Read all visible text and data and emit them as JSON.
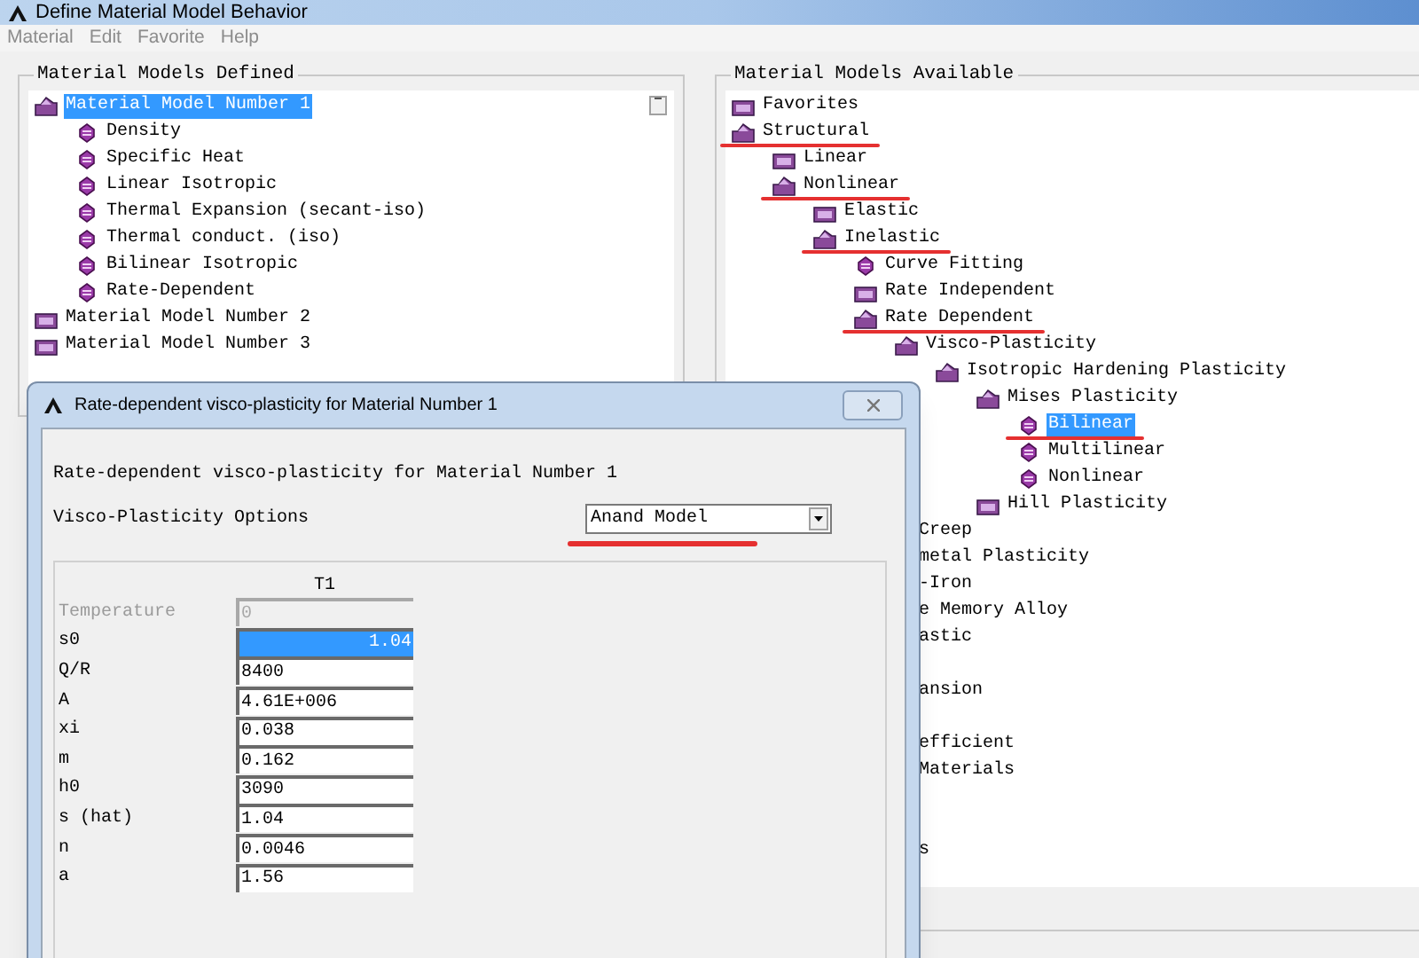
{
  "window": {
    "title": "Define Material Model Behavior"
  },
  "menu": [
    "Material",
    "Edit",
    "Favorite",
    "Help"
  ],
  "defined_panel": {
    "title": "Material Models Defined",
    "items": [
      {
        "label": "Material Model Number 1",
        "kind": "folder",
        "expanded": true,
        "selected": true,
        "children": [
          {
            "label": "Density",
            "kind": "model",
            "selected": false
          },
          {
            "label": "Specific Heat",
            "kind": "model",
            "selected": false
          },
          {
            "label": "Linear Isotropic",
            "kind": "model",
            "selected": false
          },
          {
            "label": "Thermal Expansion (secant-iso)",
            "kind": "model",
            "selected": false
          },
          {
            "label": "Thermal conduct. (iso)",
            "kind": "model",
            "selected": false
          },
          {
            "label": "Bilinear Isotropic",
            "kind": "model",
            "selected": false
          },
          {
            "label": "Rate-Dependent",
            "kind": "model",
            "selected": false
          }
        ]
      },
      {
        "label": "Material Model Number 2",
        "kind": "folder",
        "expanded": false,
        "selected": false
      },
      {
        "label": "Material Model Number 3",
        "kind": "folder",
        "expanded": false,
        "selected": false
      }
    ]
  },
  "available_panel": {
    "title": "Material Models Available",
    "items": [
      {
        "label": "Favorites",
        "kind": "folder",
        "expanded": false,
        "selected": false,
        "annotated": false
      },
      {
        "label": "Structural",
        "kind": "folder",
        "expanded": true,
        "selected": false,
        "annotated": true,
        "children": [
          {
            "label": "Linear",
            "kind": "folder",
            "expanded": false,
            "selected": false,
            "annotated": false
          },
          {
            "label": "Nonlinear",
            "kind": "folder",
            "expanded": true,
            "selected": false,
            "annotated": true,
            "children": [
              {
                "label": "Elastic",
                "kind": "folder",
                "expanded": false,
                "selected": false,
                "annotated": false
              },
              {
                "label": "Inelastic",
                "kind": "folder",
                "expanded": true,
                "selected": false,
                "annotated": true,
                "children": [
                  {
                    "label": "Curve Fitting",
                    "kind": "model",
                    "selected": false,
                    "annotated": false
                  },
                  {
                    "label": "Rate Independent",
                    "kind": "folder",
                    "expanded": false,
                    "selected": false,
                    "annotated": false
                  },
                  {
                    "label": "Rate Dependent",
                    "kind": "folder",
                    "expanded": true,
                    "selected": false,
                    "annotated": true,
                    "children": [
                      {
                        "label": "Visco-Plasticity",
                        "kind": "folder",
                        "expanded": true,
                        "selected": false,
                        "annotated": false,
                        "children": [
                          {
                            "label": "Isotropic Hardening Plasticity",
                            "kind": "folder",
                            "expanded": true,
                            "selected": false,
                            "annotated": false,
                            "children": [
                              {
                                "label": "Mises Plasticity",
                                "kind": "folder",
                                "expanded": true,
                                "selected": false,
                                "annotated": false,
                                "children": [
                                  {
                                    "label": "Bilinear",
                                    "kind": "model",
                                    "selected": true,
                                    "annotated": true
                                  },
                                  {
                                    "label": "Multilinear",
                                    "kind": "model",
                                    "selected": false,
                                    "annotated": false
                                  },
                                  {
                                    "label": "Nonlinear",
                                    "kind": "model",
                                    "selected": false,
                                    "annotated": false
                                  }
                                ]
                              },
                              {
                                "label": "Hill Plasticity",
                                "kind": "folder",
                                "expanded": false,
                                "selected": false,
                                "annotated": false
                              }
                            ]
                          }
                        ]
                      }
                    ]
                  }
                ]
              }
            ]
          }
        ]
      }
    ],
    "covered_rows": [
      {
        "kind": "text",
        "text": "Creep"
      },
      {
        "kind": "text",
        "text": "metal Plasticity"
      },
      {
        "kind": "text",
        "text": "-Iron"
      },
      {
        "kind": "text",
        "text": "e Memory Alloy"
      },
      {
        "kind": "text",
        "text": "astic"
      },
      {
        "kind": "hidden"
      },
      {
        "kind": "text",
        "text": "ansion"
      },
      {
        "kind": "hidden"
      },
      {
        "kind": "text",
        "text": "efficient"
      },
      {
        "kind": "text",
        "text": "Materials"
      },
      {
        "kind": "hidden"
      },
      {
        "kind": "hidden"
      },
      {
        "kind": "text",
        "text": "s"
      }
    ]
  },
  "dialog": {
    "title": "Rate-dependent visco-plasticity  for Material Number 1",
    "heading": "Rate-dependent visco-plasticity  for Material Number 1",
    "option_label": "Visco-Plasticity Options",
    "option_value": "Anand Model",
    "option_annotated": true,
    "table": {
      "columns": [
        "T1"
      ],
      "rows": [
        {
          "label": "Temperature",
          "value": "0",
          "disabled": true,
          "selected": false
        },
        {
          "label": "s0",
          "value": "1.04",
          "disabled": false,
          "selected": true
        },
        {
          "label": "Q/R",
          "value": "8400",
          "disabled": false,
          "selected": false
        },
        {
          "label": "A",
          "value": "4.61E+006",
          "disabled": false,
          "selected": false
        },
        {
          "label": "xi",
          "value": "0.038",
          "disabled": false,
          "selected": false
        },
        {
          "label": "m",
          "value": "0.162",
          "disabled": false,
          "selected": false
        },
        {
          "label": "h0",
          "value": "3090",
          "disabled": false,
          "selected": false
        },
        {
          "label": "s (hat)",
          "value": "1.04",
          "disabled": false,
          "selected": false
        },
        {
          "label": "n",
          "value": "0.0046",
          "disabled": false,
          "selected": false
        },
        {
          "label": "a",
          "value": "1.56",
          "disabled": false,
          "selected": false
        }
      ]
    }
  }
}
